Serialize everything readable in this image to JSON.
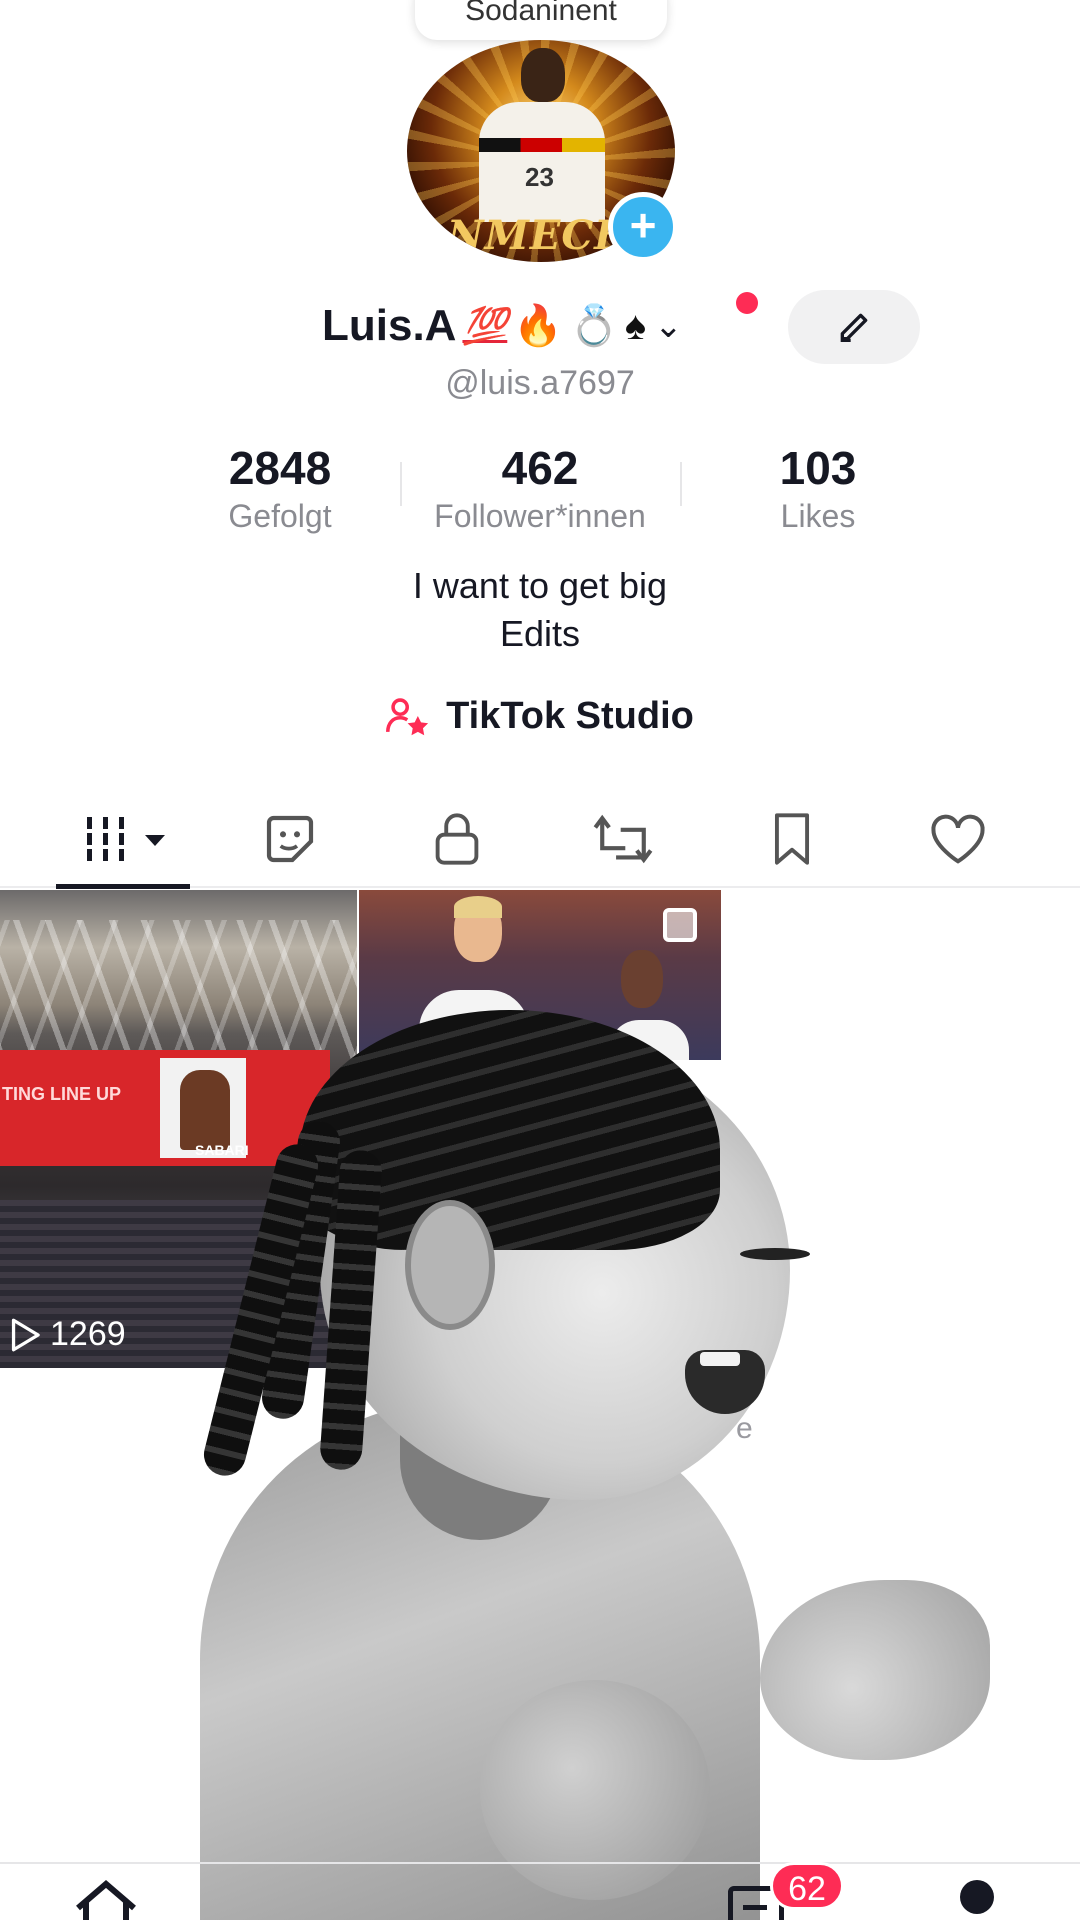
{
  "top_popup": {
    "label": "Sodaninent"
  },
  "profile": {
    "name": "Luis.A",
    "name_emojis": {
      "hundred": "💯",
      "fire": "🔥",
      "ring": "💍",
      "spade": "♠"
    },
    "handle": "@luis.a7697",
    "bio_line1": "I want to get big",
    "bio_line2": "Edits",
    "avatar_caption": "NMECH",
    "avatar_jersey_number": "23"
  },
  "stats": [
    {
      "value": "2848",
      "label": "Gefolgt"
    },
    {
      "value": "462",
      "label": "Follower*innen"
    },
    {
      "value": "103",
      "label": "Likes"
    }
  ],
  "studio": {
    "label": "TikTok Studio"
  },
  "tabs": [
    "videos-grid",
    "stickers",
    "private",
    "reposts",
    "favorites",
    "liked"
  ],
  "videos": [
    {
      "views": "1269",
      "screen_text": "TING LINE UP",
      "player_name": "SABARI"
    }
  ],
  "ghost_text": "e",
  "navbar": {
    "inbox_badge": "62"
  },
  "colors": {
    "accent": "#fe2c55",
    "add_badge": "#3ab5f0"
  }
}
